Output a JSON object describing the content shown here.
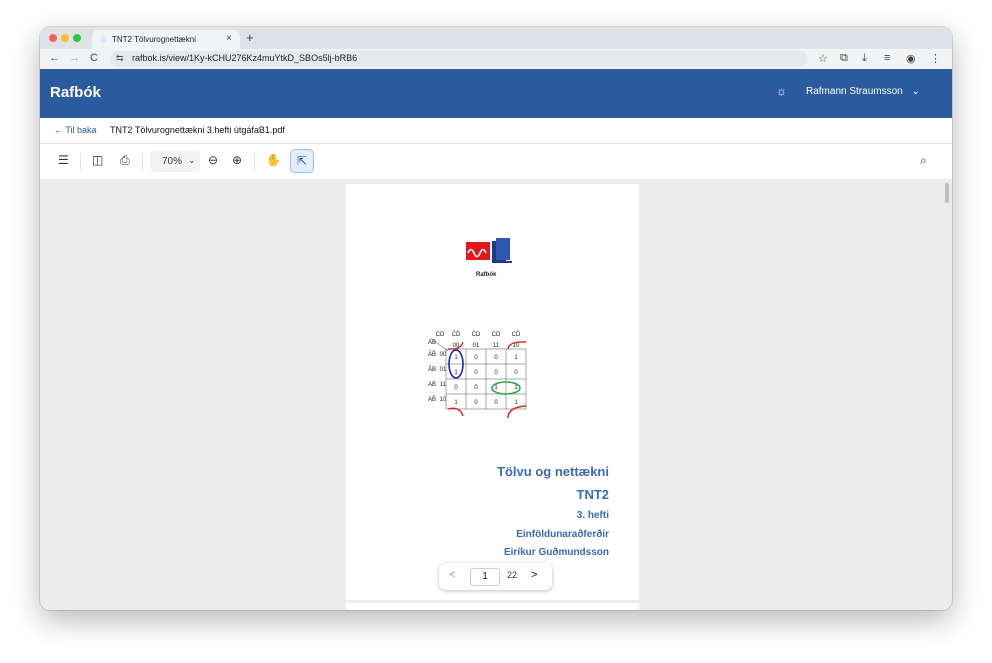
{
  "browser": {
    "tab_title": "TNT2 Tölvurognettækni",
    "tab_close": "×",
    "new_tab": "+",
    "site_icon": "⇆",
    "url": "rafbok.is/view/1Ky-kCHU276Kz4muYtkD_SBOs5lj-bRB6",
    "icons": [
      "back-arrow-icon",
      "forward-arrow-icon",
      "reload-icon",
      "star-icon",
      "extensions-icon",
      "download-icon",
      "reading-list-icon",
      "profile-icon",
      "menu-dots-icon"
    ],
    "glyphs": {
      "back": "←",
      "forward": "→",
      "reload": "C",
      "star": "☆",
      "ext": "⧉",
      "download": "⤓",
      "reading": "≡",
      "profile": "◉",
      "menu": "⋮"
    },
    "traffic_lights": {
      "close": "#ff5f57",
      "minimize": "#febc2e",
      "zoom": "#28c840"
    }
  },
  "app": {
    "brand": "Rafbók",
    "theme_icon": "☼",
    "user_name": "Rafmann Straumsson",
    "user_chevron": "⌄",
    "accent": "#2b5b9e"
  },
  "breadcrumb": {
    "back_label": "← Til baka",
    "doc_title": "TNT2 Tölvurognettækni 3.hefti útgáfaB1.pdf"
  },
  "toolbar": {
    "menu": "☰",
    "sidebar": "◫",
    "export": "⎙",
    "zoom_value": "70%",
    "zoom_chevron": "⌄",
    "zoom_out": "⊖",
    "zoom_in": "⊕",
    "hand": "✋",
    "select": "⇱",
    "search": "⌕"
  },
  "pdf_page": {
    "logo_label": "Rafbók",
    "kmap": {
      "corner_top": "CD",
      "corner_left": "AB",
      "col_vars": [
        "CD",
        "C̄D̄",
        "C̄D",
        "CD",
        "CD̄"
      ],
      "col_codes": [
        "00",
        "01",
        "11",
        "10"
      ],
      "row_vars": [
        "ĀB̄",
        "ĀB",
        "AB",
        "AB̄"
      ],
      "row_codes": [
        "00",
        "01",
        "11",
        "10"
      ],
      "cells": [
        [
          "1",
          "0",
          "0",
          "1"
        ],
        [
          "1",
          "0",
          "0",
          "0"
        ],
        [
          "0",
          "0",
          "1",
          "1"
        ],
        [
          "1",
          "0",
          "0",
          "1"
        ]
      ]
    },
    "title_lines": [
      "Tölvu og nettækni",
      "TNT2",
      "3. hefti",
      "Einföldunaraðferðir",
      "Eiríkur Guðmundsson"
    ]
  },
  "pager": {
    "prev": "<",
    "current": "1",
    "total": "22",
    "next": ">"
  }
}
